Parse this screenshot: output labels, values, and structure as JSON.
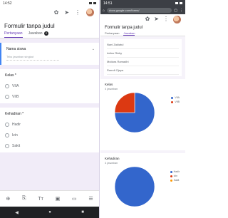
{
  "left": {
    "status": {
      "time": "14:52"
    },
    "form": {
      "title": "Formulir tanpa judul",
      "tabs": [
        {
          "label": "Pertanyaan"
        },
        {
          "label": "Jawaban",
          "badge": "2"
        }
      ]
    },
    "questions": [
      {
        "title": "Nama siswa",
        "placeholder": "Teks jawaban singkat"
      },
      {
        "title": "Kelas *",
        "options": [
          "VIIA",
          "VIIB"
        ]
      },
      {
        "title": "Kehadiran *",
        "options": [
          "Hadir",
          "Izin",
          "Sakit"
        ]
      }
    ],
    "bottom_tools": [
      "⊕",
      "⎘",
      "Tт",
      "▣",
      "▭",
      "☰"
    ],
    "nav": [
      "◀",
      "●",
      "■"
    ]
  },
  "right": {
    "status": {
      "time": "14:51"
    },
    "url": "docs.google.com/forms/",
    "form": {
      "title": "Formulir tanpa judul",
      "tabs": [
        {
          "label": "Pertanyaan"
        },
        {
          "label": "Jawaban"
        }
      ]
    },
    "responses": [
      "Nani Zakiatul",
      "Adino Rizky",
      "Mutiara Ramadhi",
      "Ramdi Ojaya"
    ],
    "charts_text": {
      "c1_title": "Kelas",
      "c1_sub": "4 jawaban",
      "c1_legend": [
        "VIIA",
        "VIIB"
      ],
      "c2_title": "Kehadiran",
      "c2_sub": "4 jawaban",
      "c2_legend": [
        "Hadir",
        "Izin",
        "Sakit"
      ]
    }
  },
  "colors": {
    "accent": "#673ab7",
    "blue": "#3366cc",
    "red": "#dc3912",
    "orange": "#ff9900"
  },
  "chart_data": [
    {
      "type": "pie",
      "title": "Kelas",
      "categories": [
        "VIIA",
        "VIIB"
      ],
      "values": [
        75,
        25
      ]
    },
    {
      "type": "pie",
      "title": "Kehadiran",
      "categories": [
        "Hadir",
        "Izin",
        "Sakit"
      ],
      "values": [
        100,
        0,
        0
      ]
    }
  ]
}
